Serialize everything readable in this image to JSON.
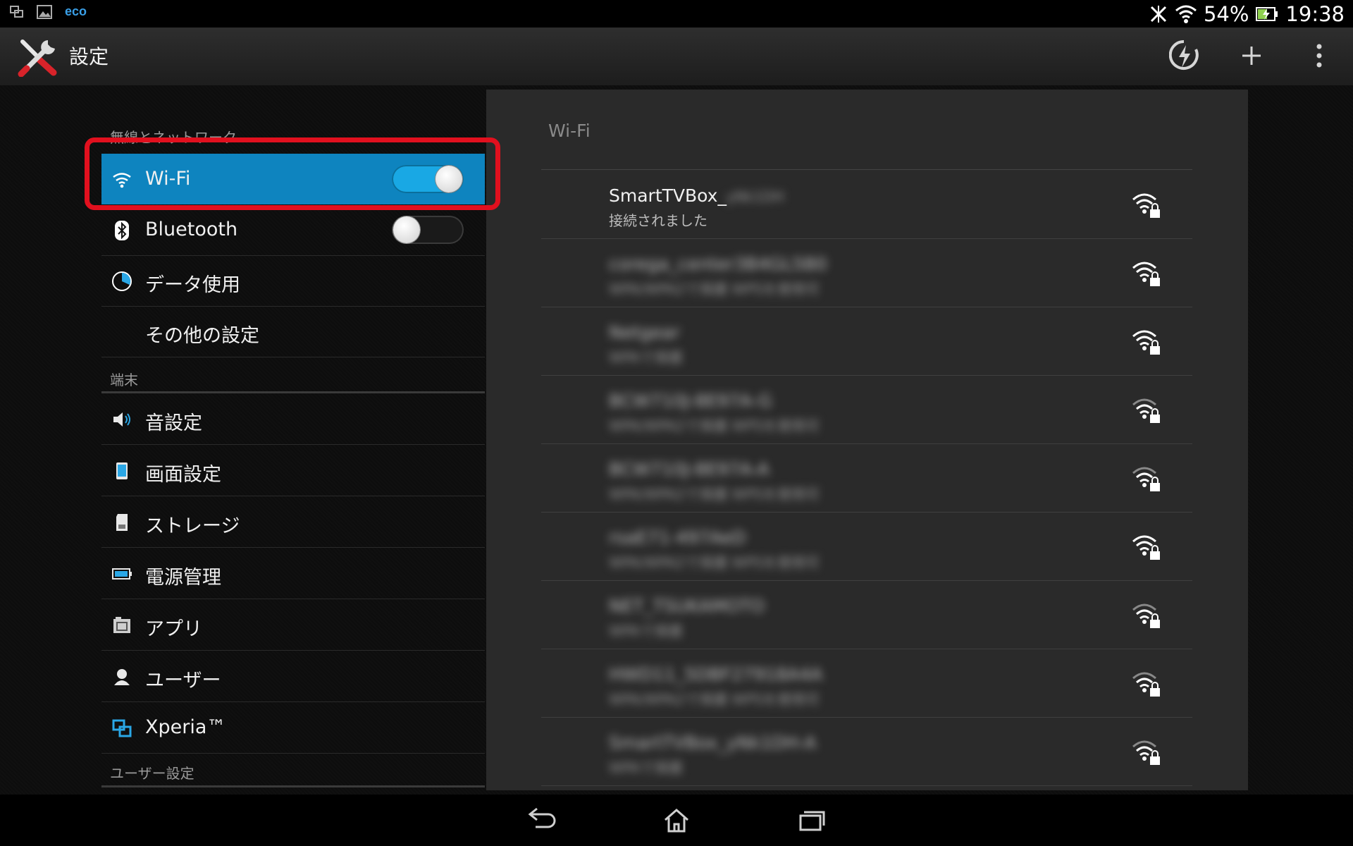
{
  "statusbar": {
    "battery": "54%",
    "time": "19:38",
    "left_icons": [
      "screens-icon",
      "gallery-icon",
      "eco-icon"
    ],
    "eco_label": "eco"
  },
  "actionbar": {
    "title": "設定",
    "actions": [
      "sync-icon",
      "plus-icon",
      "overflow-icon"
    ]
  },
  "sidebar": {
    "categories": [
      "無線とネットワーク",
      "端末",
      "ユーザー設定"
    ],
    "items": [
      {
        "label": "Wi-Fi",
        "icon": "wifi-icon",
        "toggle": true,
        "selected": true
      },
      {
        "label": "Bluetooth",
        "icon": "bluetooth-icon",
        "toggle": false
      },
      {
        "label": "データ使用",
        "icon": "data-usage-icon"
      },
      {
        "label": "その他の設定",
        "icon": ""
      },
      {
        "label": "音設定",
        "icon": "speaker-icon"
      },
      {
        "label": "画面設定",
        "icon": "display-icon"
      },
      {
        "label": "ストレージ",
        "icon": "sd-card-icon"
      },
      {
        "label": "電源管理",
        "icon": "battery-icon"
      },
      {
        "label": "アプリ",
        "icon": "apps-icon"
      },
      {
        "label": "ユーザー",
        "icon": "user-icon"
      },
      {
        "label": "Xperia™",
        "icon": "xperia-icon"
      }
    ]
  },
  "panel": {
    "title": "Wi-Fi",
    "networks": [
      {
        "ssid": "SmartTVBox_",
        "ssid_blurred": "yNk1DH",
        "status": "接続されました",
        "blurred": false
      },
      {
        "ssid": "corega_center3B4GL5B0",
        "status": "WPA/WPA2で保護   WPSを使用可",
        "blurred": true
      },
      {
        "ssid": "Netgear",
        "status": "WPAで保護",
        "blurred": true
      },
      {
        "ssid": "BCW710J-8E97A-G",
        "status": "WPA/WPA2で保護   WPSを使用可",
        "blurred": true
      },
      {
        "ssid": "BCW710J-8E97A-A",
        "status": "WPA/WPA2で保護   WPSを使用可",
        "blurred": true
      },
      {
        "ssid": "rsaE71-497AeD",
        "status": "WPA/WPA2で保護   WPSを使用可",
        "blurred": true
      },
      {
        "ssid": "NET_TSUKAMOTO",
        "status": "WPAで保護",
        "blurred": true
      },
      {
        "ssid": "HWD11_5DBF27918A4A",
        "status": "WPA/WPA2で保護   WPSを使用可",
        "blurred": true
      },
      {
        "ssid": "SmartTVBox_yNk1DH-A",
        "status": "WPAで保護",
        "blurred": true
      }
    ]
  },
  "colors": {
    "accent": "#0e84bf",
    "highlight": "#e1101e",
    "toggle_on": "#19a8e4"
  },
  "navbar": {
    "buttons": [
      "back-icon",
      "home-icon",
      "recents-icon"
    ]
  }
}
